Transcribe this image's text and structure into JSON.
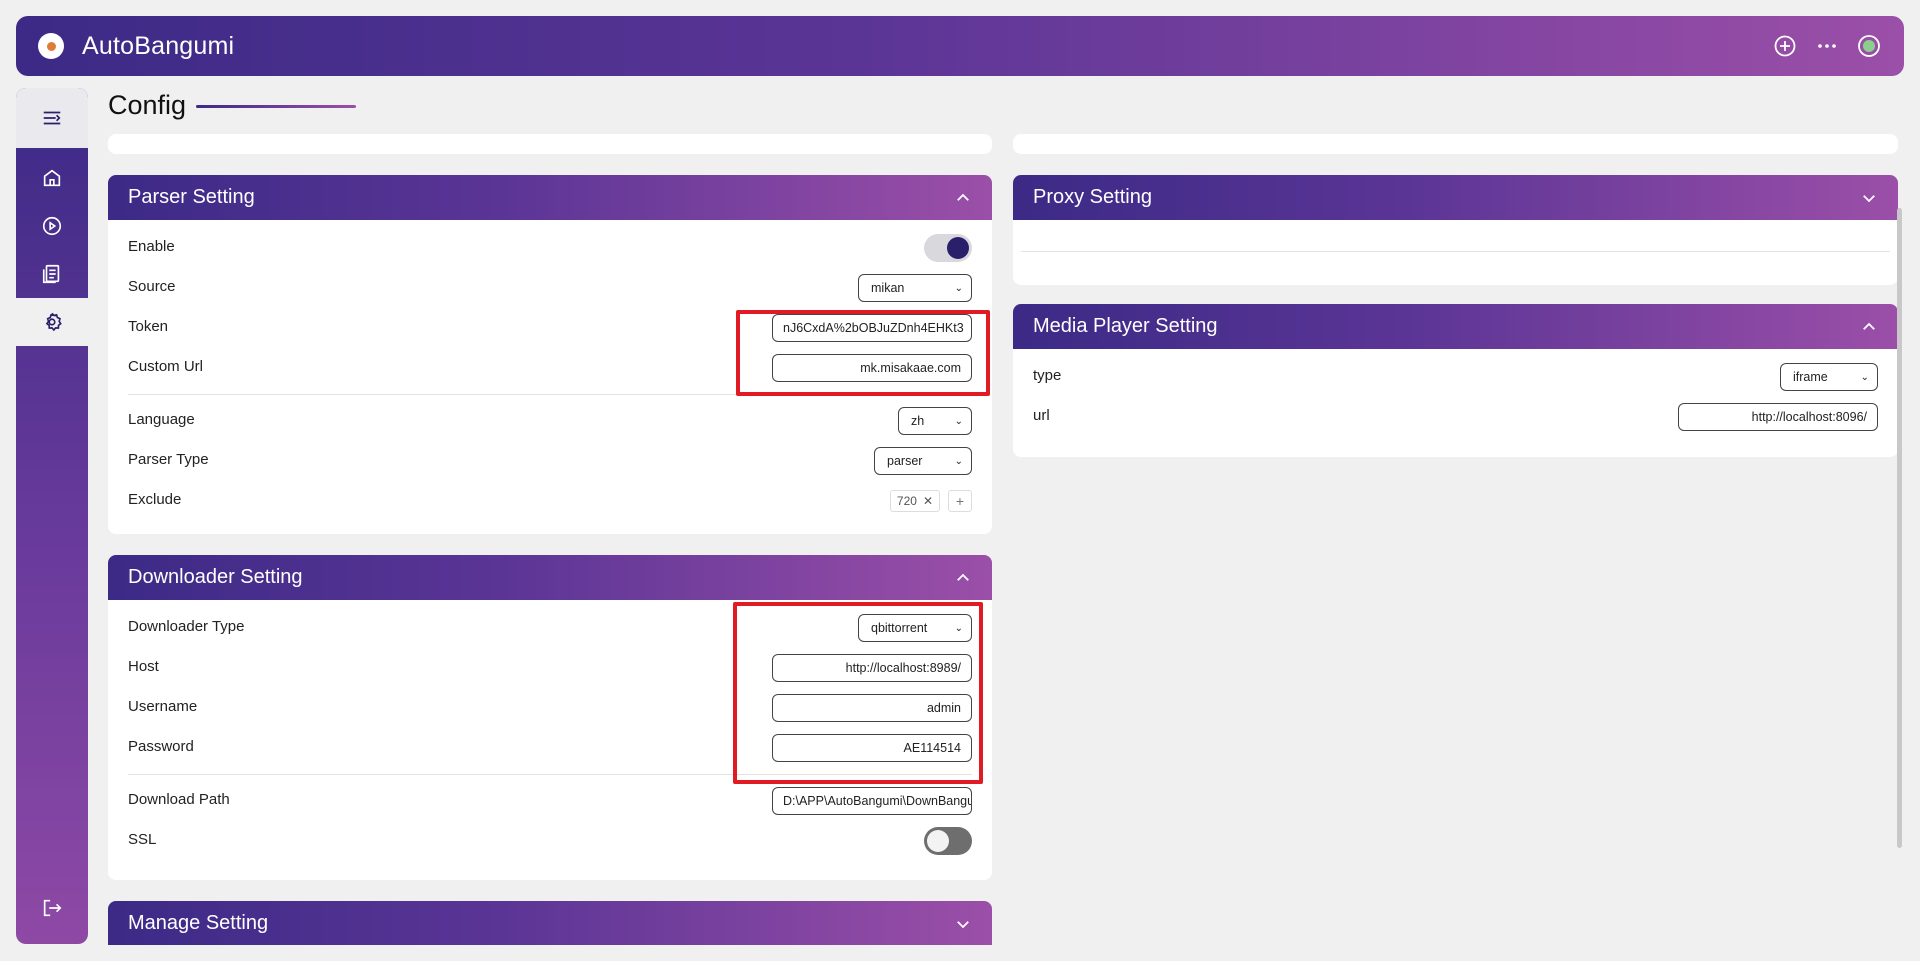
{
  "app": {
    "title": "AutoBangumi"
  },
  "header_icons": [
    "plus-circle-icon",
    "more-icon",
    "status-icon"
  ],
  "colors": {
    "brand_start": "#3c2a86",
    "brand_end": "#9b4fa8",
    "highlight": "#e01b24",
    "toggle_on": "#2a1f6b"
  },
  "sidebar": {
    "items": [
      "menu-icon",
      "home-icon",
      "play-icon",
      "log-icon",
      "settings-icon"
    ],
    "active": "settings-icon",
    "bottom": "logout-icon"
  },
  "page": {
    "title": "Config"
  },
  "parser": {
    "title": "Parser Setting",
    "enable_label": "Enable",
    "enable_on": true,
    "source_label": "Source",
    "source_value": "mikan",
    "token_label": "Token",
    "token_value": "nJ6CxdA%2bOBJuZDnh4EHKt3",
    "custom_url_label": "Custom Url",
    "custom_url_value": "mk.misakaae.com",
    "language_label": "Language",
    "language_value": "zh",
    "parser_type_label": "Parser Type",
    "parser_type_value": "parser",
    "exclude_label": "Exclude",
    "exclude_tags": [
      "720"
    ]
  },
  "downloader": {
    "title": "Downloader Setting",
    "type_label": "Downloader Type",
    "type_value": "qbittorrent",
    "host_label": "Host",
    "host_value": "http://localhost:8989/",
    "username_label": "Username",
    "username_value": "admin",
    "password_label": "Password",
    "password_value": "AE114514",
    "path_label": "Download Path",
    "path_value": "D:\\APP\\AutoBangumi\\DownBangumi",
    "ssl_label": "SSL",
    "ssl_on": false
  },
  "manage": {
    "title": "Manage Setting"
  },
  "proxy": {
    "title": "Proxy Setting"
  },
  "media_player": {
    "title": "Media Player Setting",
    "type_label": "type",
    "type_value": "iframe",
    "url_label": "url",
    "url_value": "http://localhost:8096/"
  }
}
